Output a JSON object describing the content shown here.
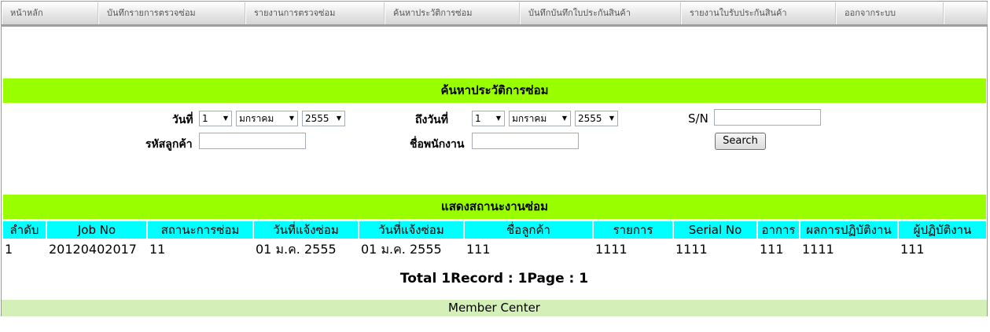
{
  "nav": {
    "items": [
      {
        "label": "หน้าหลัก"
      },
      {
        "label": "บันทึกรายการตรวจซ่อม"
      },
      {
        "label": "รายงานการตรวจซ่อม"
      },
      {
        "label": "ค้นหาประวัติการซ่อม"
      },
      {
        "label": "บันทึกบันทึกใบประกันสินค้า"
      },
      {
        "label": "รายงานใบรับประกันสินค้า"
      },
      {
        "label": "ออกจากระบบ"
      },
      {
        "label": ""
      }
    ]
  },
  "search": {
    "title": "ค้นหาประวัติการซ่อม",
    "date_from_label": "วันที่",
    "date_from": {
      "day": "1",
      "month": "มกราคม",
      "year": "2555"
    },
    "date_to_label": "ถึงวันที่",
    "date_to": {
      "day": "1",
      "month": "มกราคม",
      "year": "2555"
    },
    "sn_label": "S/N",
    "sn_value": "",
    "customer_code_label": "รหัสลูกค้า",
    "customer_code_value": "",
    "employee_name_label": "ชื่อพนักงาน",
    "employee_name_value": "",
    "search_button": "Search"
  },
  "status": {
    "title": "แสดงสถานะงานซ่อม",
    "columns": [
      "ลำดับ",
      "Job No",
      "สถานะการซ่อม",
      "วันที่แจ้งซ่อม",
      "วันที่แจ้งซ่อม",
      "ชื่อลูกค้า",
      "รายการ",
      "Serial No",
      "อาการ",
      "ผลการปฏิบัติงาน",
      "ผู้ปฏิบัติงาน"
    ],
    "rows": [
      [
        "1",
        "20120402017",
        "11",
        "01 ม.ค. 2555",
        "01 ม.ค. 2555",
        "111",
        "1111",
        "1111",
        "111",
        "1111",
        "111"
      ]
    ],
    "total": "Total 1Record : 1Page : 1"
  },
  "footer": {
    "label": "Member Center"
  },
  "colors": {
    "green_bar": "#99ff00",
    "header_cyan": "#00ffff",
    "footer_bg": "#d4f0b8"
  },
  "icons": {
    "dropdown": "chevron-down-icon"
  }
}
